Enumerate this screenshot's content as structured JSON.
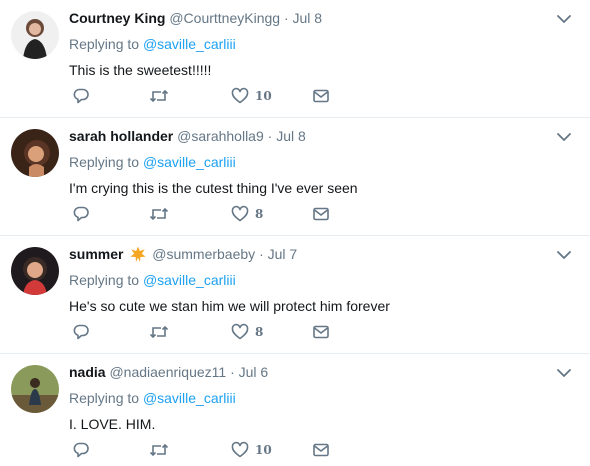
{
  "reply_prefix": "Replying to",
  "colors": {
    "accent": "#1da1f2",
    "muted": "#657786",
    "text": "#14171a",
    "divider": "#e6ecf0",
    "badge": "#f5a623"
  },
  "tweets": [
    {
      "name": "Courtney King",
      "handle": "@CourttneyKingg",
      "separator": "·",
      "time": "Jul 8",
      "reply_to": "@saville_carliii",
      "text": "This is the sweetest!!!!!",
      "likes": "10",
      "avatar": "photo-avatar"
    },
    {
      "name": "sarah hollander",
      "handle": "@sarahholla9",
      "separator": "·",
      "time": "Jul 8",
      "reply_to": "@saville_carliii",
      "text": "I'm crying this is the cutest thing I've ever seen",
      "likes": "8",
      "avatar": "photo-avatar"
    },
    {
      "name": "summer",
      "badge_icon": "star-badge-icon",
      "handle": "@summerbaeby",
      "separator": "·",
      "time": "Jul 7",
      "reply_to": "@saville_carliii",
      "text": "He's so cute we stan him we will protect him forever",
      "likes": "8",
      "avatar": "photo-avatar"
    },
    {
      "name": "nadia",
      "handle": "@nadiaenriquez11",
      "separator": "·",
      "time": "Jul 6",
      "reply_to": "@saville_carliii",
      "text": "I. LOVE. HIM.",
      "likes": "10",
      "avatar": "photo-avatar"
    }
  ]
}
